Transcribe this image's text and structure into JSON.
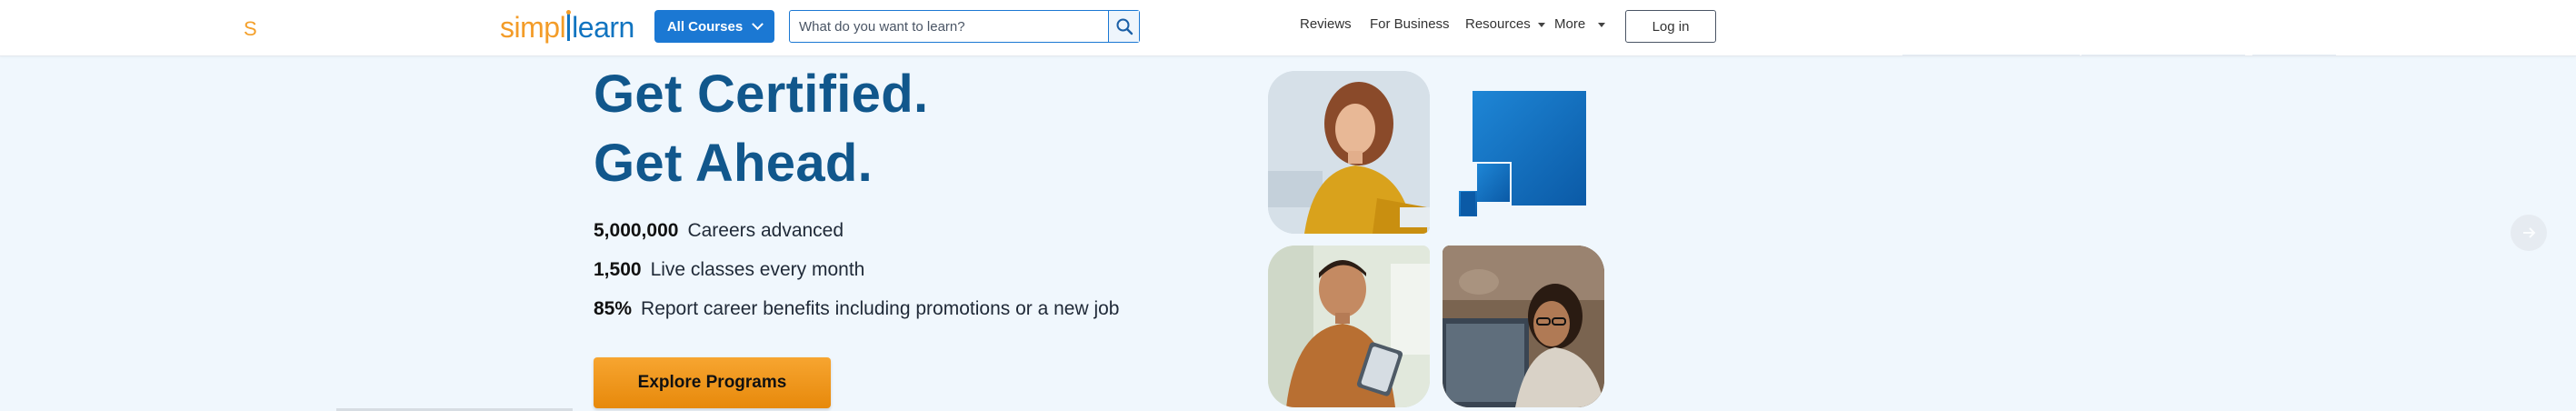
{
  "header": {
    "brand_letter": "S",
    "logo": {
      "part1": "simpl",
      "part2": "learn"
    },
    "all_courses_label": "All Courses",
    "search": {
      "placeholder": "What do you want to learn?",
      "value": ""
    },
    "nav": [
      {
        "label": "Reviews",
        "has_caret": false
      },
      {
        "label": "For Business",
        "has_caret": false
      },
      {
        "label": "Resources",
        "has_caret": true
      },
      {
        "label": "More",
        "has_caret": true
      }
    ],
    "login_label": "Log in"
  },
  "hero": {
    "title_line1": "Get Certified.",
    "title_line2": "Get Ahead.",
    "stats": [
      {
        "value": "5,000,000",
        "text": "Careers advanced"
      },
      {
        "value": "1,500",
        "text": "Live classes every month"
      },
      {
        "value": "85%",
        "text": "Report career benefits including promotions or a new job"
      }
    ],
    "cta_label": "Explore Programs"
  },
  "icons": {
    "search": "search-icon",
    "dropdown": "chevron-down-icon",
    "next": "arrow-right-icon"
  },
  "colors": {
    "primary_blue": "#1b78d3",
    "heading_blue": "#11578c",
    "cta_orange": "#f39c28",
    "page_bg": "#f0f7fd"
  }
}
